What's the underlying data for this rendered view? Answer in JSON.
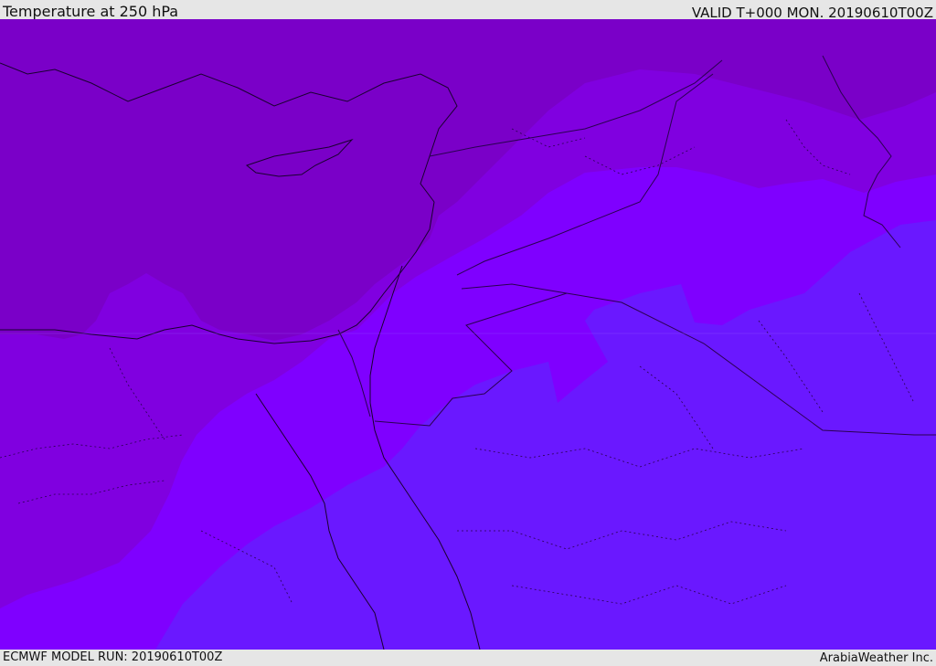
{
  "header": {
    "title": "Temperature at 250 hPa",
    "valid": "VALID T+000 MON. 20190610T00Z"
  },
  "footer": {
    "model_run": "ECMWF MODEL RUN: 20190610T00Z",
    "credit": "ArabiaWeather Inc."
  },
  "map": {
    "colors": {
      "band_coldest": "#7a00c8",
      "band_cold": "#8000e0",
      "band_mid": "#7f00ff",
      "band_warm": "#6a18ff",
      "coast_line": "#1a0030",
      "border_line": "#2a0050"
    }
  }
}
